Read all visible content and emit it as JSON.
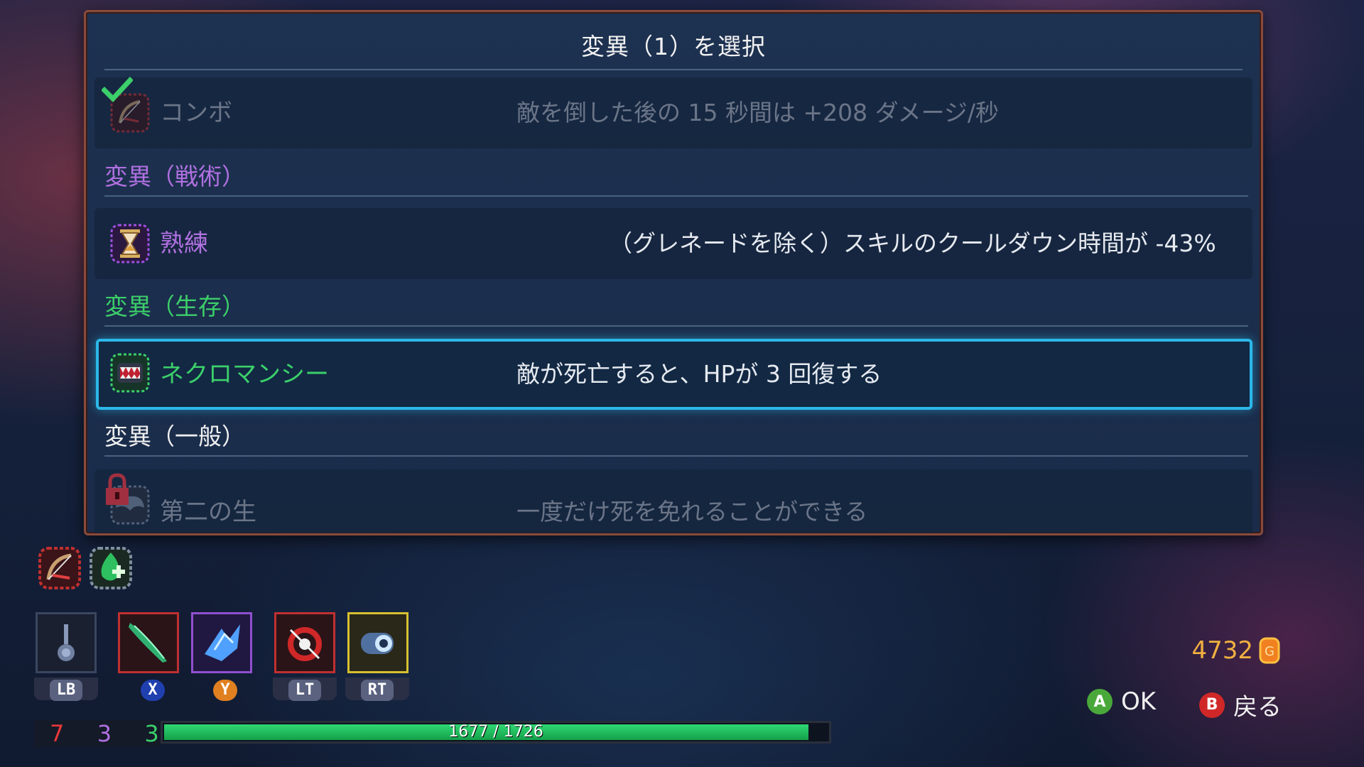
{
  "panel": {
    "title": "変異（1）を選択",
    "rows": [
      {
        "name": "コンボ",
        "desc": "敵を倒した後の 15 秒間は +208 ダメージ/秒",
        "state": "owned"
      },
      {
        "name": "熟練",
        "desc": "（グレネードを除く）スキルのクールダウン時間が -43%",
        "state": "normal"
      },
      {
        "name": "ネクロマンシー",
        "desc": "敵が死亡すると、HPが 3 回復する",
        "state": "selected"
      },
      {
        "name": "第二の生",
        "desc": "一度だけ死を免れることができる",
        "state": "locked"
      }
    ],
    "sections": [
      {
        "label": "変異（戦術）",
        "color": "#b070e0"
      },
      {
        "label": "変異（生存）",
        "color": "#3ccf6a"
      },
      {
        "label": "変異（一般）",
        "color": "#f0f0f0"
      }
    ]
  },
  "colors": {
    "tactics": "#b070e0",
    "survival": "#3ccf6a",
    "brutality": "#d84040",
    "selected_border": "#2cb8e8"
  },
  "hud": {
    "equipped_mutation_icons": [
      "combo-bow-icon",
      "green-regen-icon"
    ],
    "items": [
      {
        "icon": "potion-flask-icon",
        "key": "LB",
        "border": "#3a4660"
      },
      {
        "icon": "green-blade-icon",
        "key": "X",
        "border": "#c03030"
      },
      {
        "icon": "ice-shard-icon",
        "key": "Y",
        "border": "#9050d0"
      },
      {
        "icon": "crossbow-trap-icon",
        "key": "LT",
        "border": "#c03030"
      },
      {
        "icon": "eye-orb-icon",
        "key": "RT",
        "border": "#d8c030"
      }
    ],
    "scrolls": {
      "brutality": "7",
      "tactics": "3",
      "survival": "3"
    },
    "hp": {
      "current": 1677,
      "max": 1726,
      "text": "1677 / 1726"
    },
    "gold": "4732",
    "buttons": [
      {
        "glyph": "A",
        "label": "OK",
        "color": "#4aa83a"
      },
      {
        "glyph": "B",
        "label": "戻る",
        "color": "#d02828"
      }
    ]
  }
}
